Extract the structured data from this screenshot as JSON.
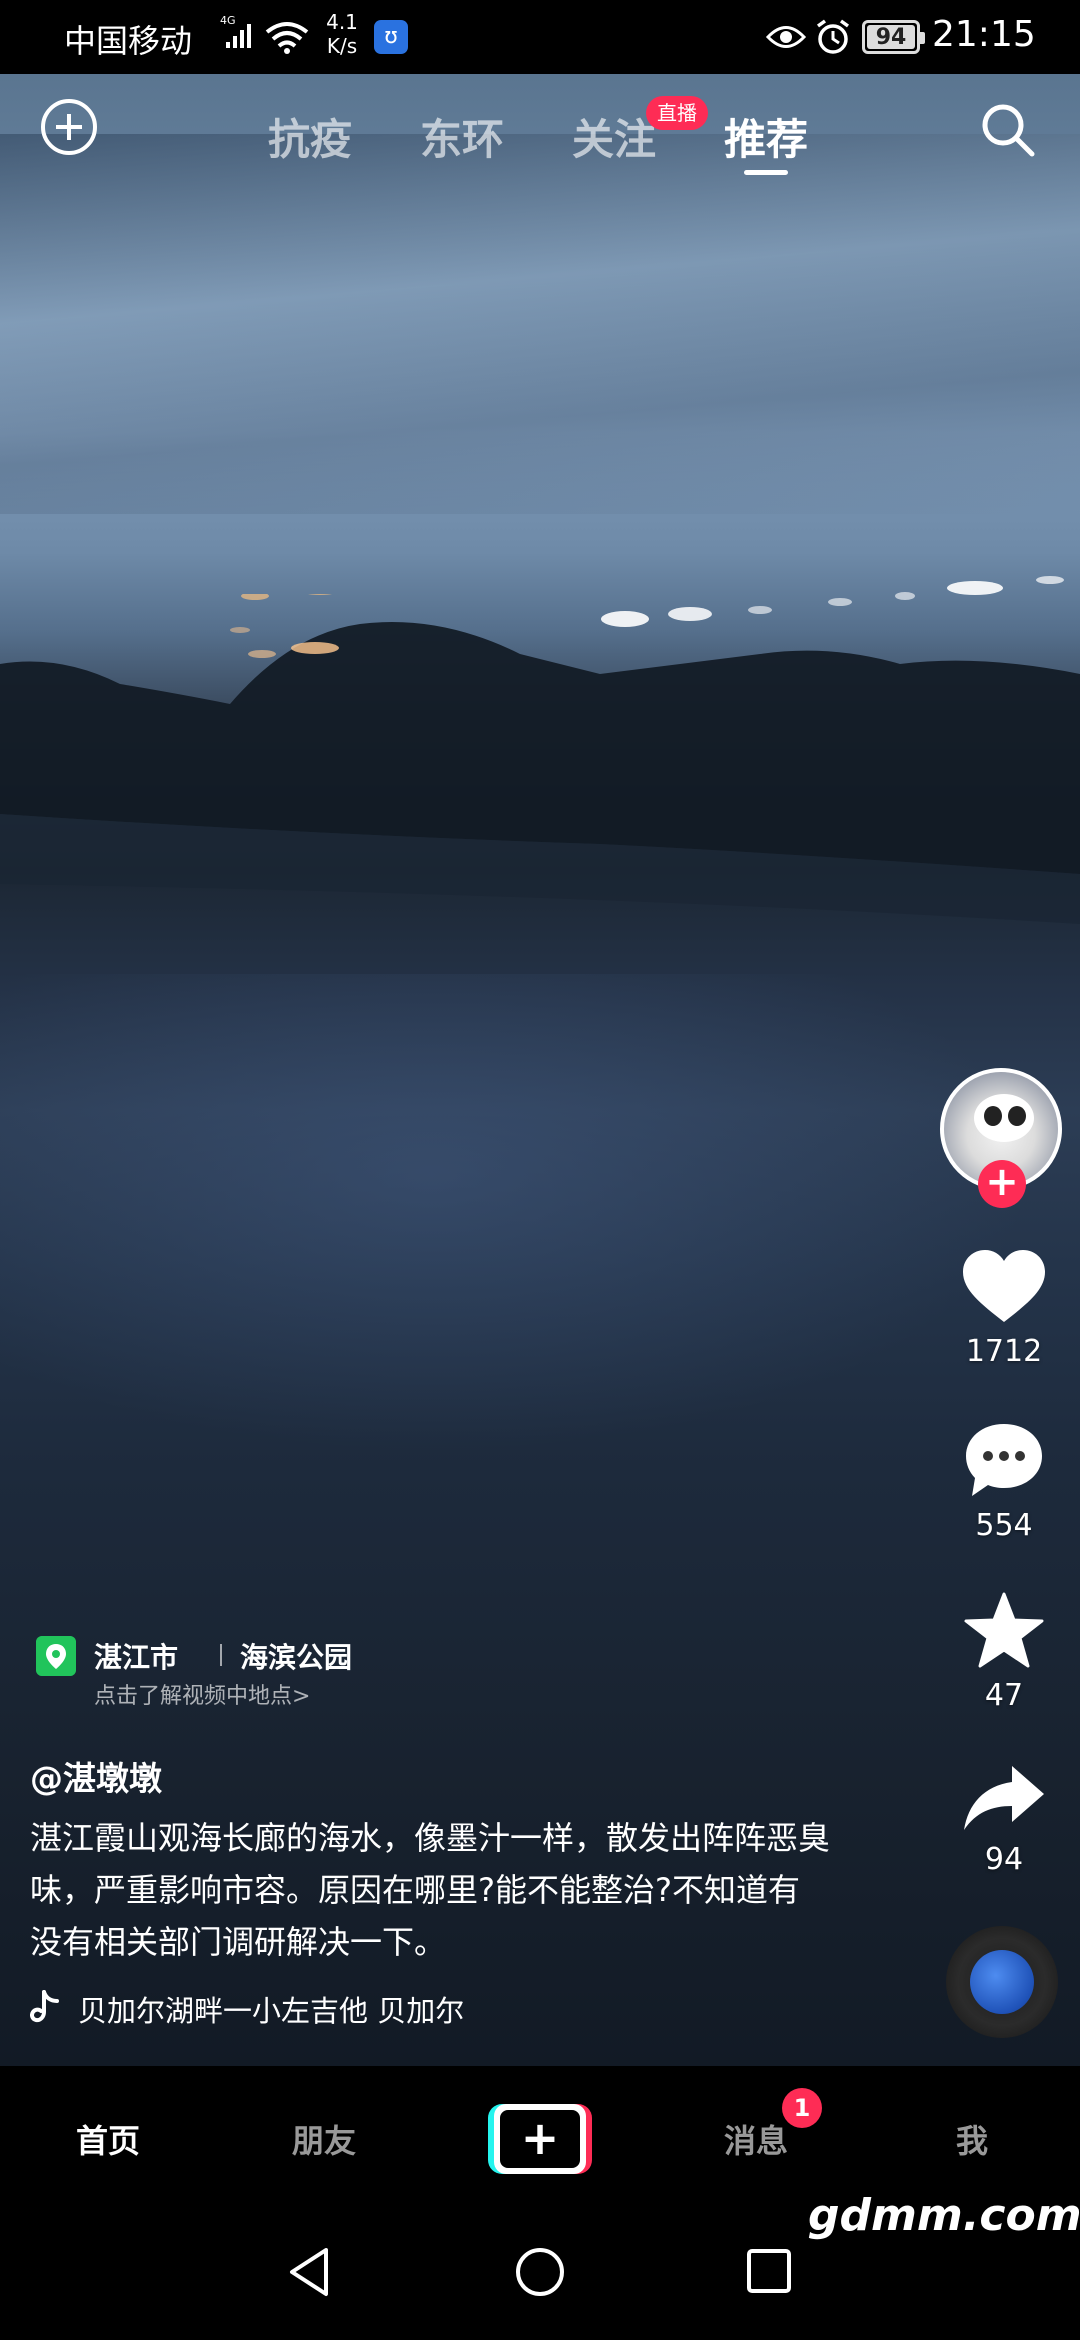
{
  "status_bar": {
    "carrier": "中国移动",
    "network": "4G",
    "speed_value": "4.1",
    "speed_unit": "K/s",
    "battery": "94",
    "time": "21:15",
    "icons": [
      "signal-icon",
      "wifi-icon",
      "app-notification-icon",
      "eye-icon",
      "alarm-icon",
      "battery-icon"
    ]
  },
  "top_tabs": {
    "items": [
      {
        "label": "抗疫",
        "active": false
      },
      {
        "label": "东环",
        "active": false
      },
      {
        "label": "关注",
        "active": false
      },
      {
        "label": "推荐",
        "active": true
      }
    ],
    "live_badge": "直播",
    "left_icon": "add-circle-icon",
    "right_icon": "search-icon"
  },
  "actions": {
    "like_count": "1712",
    "comment_count": "554",
    "favorite_count": "47",
    "share_count": "94"
  },
  "location": {
    "city": "湛江市",
    "place": "海滨公园",
    "subtitle": "点击了解视频中地点>"
  },
  "post": {
    "author": "@湛墩墩",
    "description": "湛江霞山观海长廊的海水，像墨汁一样，散发出阵阵恶臭味，严重影响市容。原因在哪里?能不能整治?不知道有没有相关部门调研解决一下。",
    "music": "贝加尔湖畔一小左吉他    贝加尔"
  },
  "bottom_nav": {
    "home": "首页",
    "friends": "朋友",
    "messages": "消息",
    "messages_badge": "1",
    "me": "我"
  },
  "watermark": "gdmm.com",
  "colors": {
    "accent": "#fe2c55",
    "cyan": "#25f4ee",
    "location_pin": "#21c45b"
  }
}
